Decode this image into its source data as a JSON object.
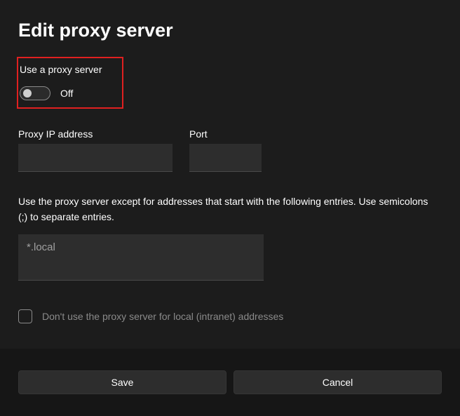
{
  "title": "Edit proxy server",
  "proxy_toggle": {
    "label": "Use a proxy server",
    "state": "Off"
  },
  "ip_field": {
    "label": "Proxy IP address",
    "value": ""
  },
  "port_field": {
    "label": "Port",
    "value": ""
  },
  "exceptions": {
    "description": "Use the proxy server except for addresses that start with the following entries. Use semicolons (;) to separate entries.",
    "value": "*.local"
  },
  "local_bypass": {
    "label": "Don't use the proxy server for local (intranet) addresses"
  },
  "buttons": {
    "save": "Save",
    "cancel": "Cancel"
  }
}
